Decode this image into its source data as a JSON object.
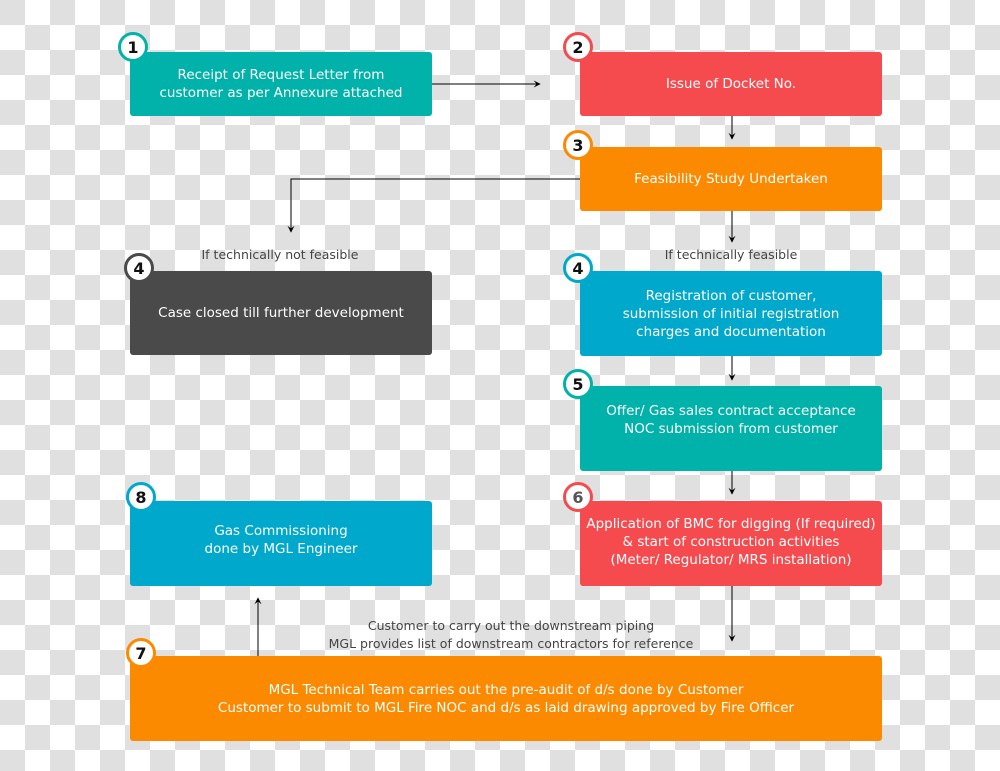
{
  "colors": {
    "teal": "#00b2a9",
    "red": "#f54b4f",
    "orange": "#fb8a01",
    "dark": "#4a4a4a",
    "blue": "#00a8cc",
    "connector": "#000000",
    "label_text": "#444444"
  },
  "steps": [
    {
      "number": "1",
      "text": "Receipt of Request Letter from\ncustomer as per Annexure attached",
      "color": "teal"
    },
    {
      "number": "2",
      "text": "Issue of Docket No.",
      "color": "red"
    },
    {
      "number": "3",
      "text": "Feasibility Study Undertaken",
      "color": "orange"
    },
    {
      "number": "4",
      "text": "Case closed till further development",
      "color": "dark"
    },
    {
      "number": "4",
      "text": "Registration of customer,\nsubmission of initial registration\ncharges and documentation",
      "color": "blue"
    },
    {
      "number": "5",
      "text": "Offer/ Gas sales contract acceptance\nNOC submission from customer",
      "color": "teal"
    },
    {
      "number": "6",
      "text": "Application of BMC for digging (If required)\n& start of construction activities\n(Meter/ Regulator/ MRS installation)",
      "color": "red"
    },
    {
      "number": "8",
      "text": "Gas Commissioning\ndone by MGL Engineer",
      "color": "blue"
    },
    {
      "number": "7",
      "text": "MGL Technical Team carries out the pre-audit of d/s done by Customer\nCustomer to submit to MGL Fire NOC and d/s as laid drawing approved by Fire Officer",
      "color": "orange"
    }
  ],
  "labels": {
    "not_feasible": "If technically not feasible",
    "feasible": "If technically feasible",
    "downstream": "Customer to carry out the downstream piping\nMGL provides list of downstream contractors for reference"
  }
}
